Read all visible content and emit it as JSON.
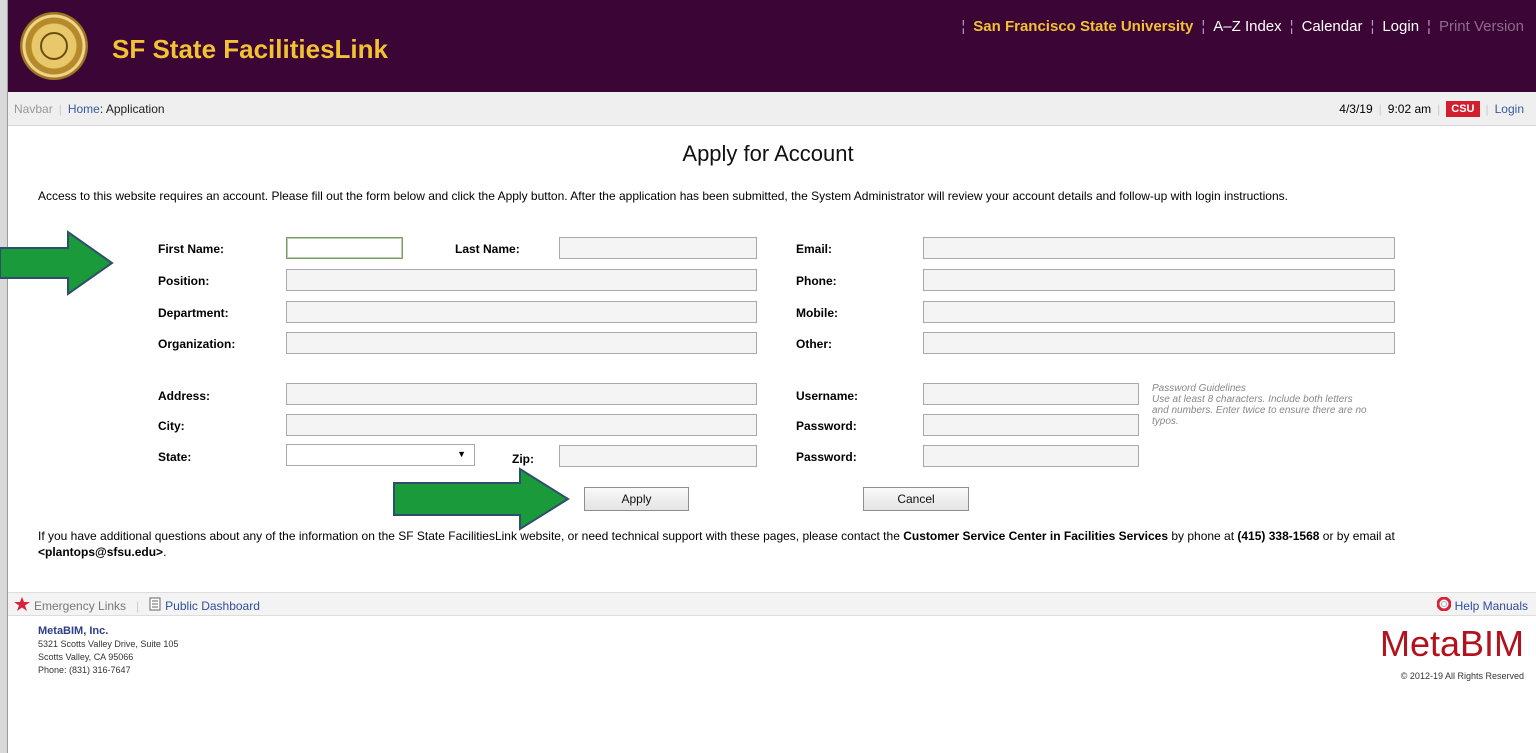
{
  "header": {
    "site_title": "SF State FacilitiesLink",
    "links": [
      {
        "label": "San Francisco State University"
      },
      {
        "label": "A–Z Index"
      },
      {
        "label": "Calendar"
      },
      {
        "label": "Login"
      },
      {
        "label": "Print Version"
      }
    ]
  },
  "subbar": {
    "navbar_label": "Navbar",
    "home_label": "Home",
    "current_page": ": Application",
    "date": "4/3/19",
    "time": "9:02 am",
    "csu_label": "CSU",
    "login_label": "Login"
  },
  "main": {
    "title": "Apply for Account",
    "intro": "Access to this website requires an account. Please fill out the form below and click the Apply button. After the application has been submitted, the System Administrator will review your account details and follow-up with login instructions."
  },
  "form": {
    "first_name_label": "First Name:",
    "last_name_label": "Last Name:",
    "email_label": "Email:",
    "position_label": "Position:",
    "phone_label": "Phone:",
    "department_label": "Department:",
    "mobile_label": "Mobile:",
    "organization_label": "Organization:",
    "other_label": "Other:",
    "address_label": "Address:",
    "username_label": "Username:",
    "city_label": "City:",
    "password_label": "Password:",
    "password_confirm_label": "Password:",
    "state_label": "State:",
    "zip_label": "Zip:",
    "values": {
      "first_name": "",
      "last_name": "",
      "email": "",
      "position": "",
      "phone": "",
      "department": "",
      "mobile": "",
      "organization": "",
      "other": "",
      "address": "",
      "username": "",
      "city": "",
      "password": "",
      "password_confirm": "",
      "state": "",
      "zip": ""
    },
    "password_guidelines_title": "Password Guidelines",
    "password_guidelines_text": "Use at least 8 characters. Include both letters and numbers. Enter twice to ensure there are no typos.",
    "apply_label": "Apply",
    "cancel_label": "Cancel"
  },
  "contact": {
    "text_1": "If you have additional questions about any of the information on the SF State FacilitiesLink website, or need technical support with these pages, please contact the ",
    "service_center": "Customer Service Center in Facilities Services",
    "text_2": " by phone at ",
    "phone": "(415) 338-1568",
    "text_3": " or by email at ",
    "email": "<plantops@sfsu.edu>",
    "text_4": "."
  },
  "footer": {
    "emergency_label": "Emergency Links",
    "dashboard_label": "Public Dashboard",
    "help_label": "Help Manuals",
    "company_name": "MetaBIM, Inc.",
    "address_line1": "5321 Scotts Valley Drive, Suite 105",
    "address_line2": "Scotts Valley, CA 95066",
    "phone_line": "Phone: (831) 316-7647",
    "brand": "MetaBIM",
    "rights": "© 2012-19 All Rights Reserved"
  },
  "colors": {
    "header_bg": "#3b0535",
    "title_gold": "#f1c232",
    "annotation_arrow": "#1a9a3a",
    "brand_red": "#b1121c"
  },
  "icons": [
    "university-seal-icon",
    "star-icon",
    "dashboard-icon",
    "lifebuoy-icon",
    "arrow-right-icon"
  ]
}
